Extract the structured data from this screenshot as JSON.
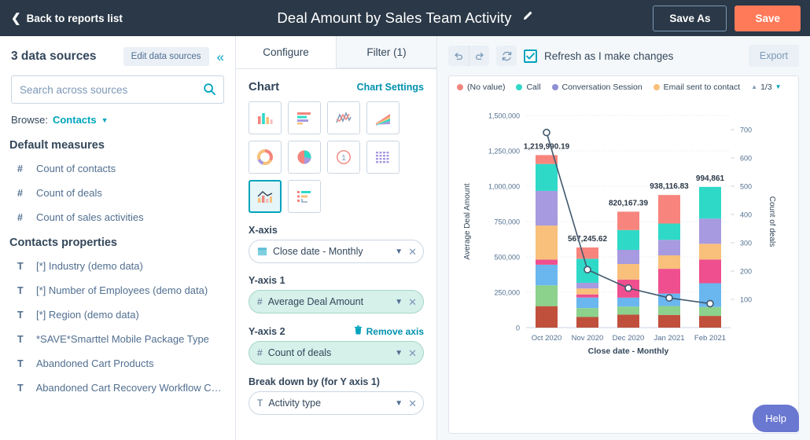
{
  "topbar": {
    "back_label": "Back to reports list",
    "back_icon": "chevron-left-icon",
    "title": "Deal Amount by Sales Team Activity",
    "edit_title_icon": "pencil-icon",
    "save_as_label": "Save As",
    "save_label": "Save",
    "bg_color": "#2a3847",
    "save_color": "#ff7a59"
  },
  "sidebar": {
    "heading": "3 data sources",
    "edit_sources_label": "Edit data sources",
    "collapse_icon": "double-chevron-left-icon",
    "search_placeholder": "Search across sources",
    "search_value": "",
    "search_icon": "search-icon",
    "browse_label": "Browse:",
    "browse_value": "Contacts",
    "sections": [
      {
        "title": "Default measures",
        "items": [
          {
            "icon": "number-icon",
            "glyph": "#",
            "label": "Count of contacts"
          },
          {
            "icon": "number-icon",
            "glyph": "#",
            "label": "Count of deals"
          },
          {
            "icon": "number-icon",
            "glyph": "#",
            "label": "Count of sales activities"
          }
        ]
      },
      {
        "title": "Contacts properties",
        "items": [
          {
            "icon": "text-icon",
            "glyph": "T",
            "label": "[*] Industry (demo data)"
          },
          {
            "icon": "text-icon",
            "glyph": "T",
            "label": "[*] Number of Employees (demo data)"
          },
          {
            "icon": "text-icon",
            "glyph": "T",
            "label": "[*] Region (demo data)"
          },
          {
            "icon": "text-icon",
            "glyph": "T",
            "label": "*SAVE*Smarttel Mobile Package Type"
          },
          {
            "icon": "text-icon",
            "glyph": "T",
            "label": "Abandoned Cart Products"
          },
          {
            "icon": "text-icon",
            "glyph": "T",
            "label": "Abandoned Cart Recovery Workflow Con..."
          }
        ]
      }
    ]
  },
  "configure": {
    "tabs": [
      {
        "label": "Configure",
        "active": true
      },
      {
        "label": "Filter (1)",
        "active": false
      }
    ],
    "chart_heading": "Chart",
    "chart_settings_label": "Chart Settings",
    "chart_types": [
      {
        "name": "vertical-bar-chart-icon",
        "selected": false
      },
      {
        "name": "horizontal-bar-chart-icon",
        "selected": false
      },
      {
        "name": "line-chart-icon",
        "selected": false
      },
      {
        "name": "area-chart-icon",
        "selected": false
      },
      {
        "name": "donut-chart-icon",
        "selected": false
      },
      {
        "name": "pie-chart-icon",
        "selected": false
      },
      {
        "name": "single-value-chart-icon",
        "selected": false
      },
      {
        "name": "table-chart-icon",
        "selected": false
      },
      {
        "name": "combination-chart-icon",
        "selected": true
      },
      {
        "name": "funnel-chart-icon",
        "selected": false
      }
    ],
    "fields": [
      {
        "label": "X-axis",
        "icon": "calendar-icon",
        "value": "Close date - Monthly",
        "green": false
      },
      {
        "label": "Y-axis 1",
        "icon": "number-icon",
        "value": "Average Deal Amount",
        "green": true
      },
      {
        "label": "Y-axis 2",
        "icon": "number-icon",
        "value": "Count of deals",
        "green": true,
        "action": "Remove axis",
        "action_icon": "trash-icon"
      },
      {
        "label": "Break down by (for Y axis 1)",
        "icon": "text-icon",
        "value": "Activity type",
        "green": false
      }
    ]
  },
  "chart_toolbar": {
    "undo_icon": "undo-icon",
    "redo_icon": "redo-icon",
    "refresh_icon": "refresh-icon",
    "refresh_checkbox_label": "Refresh as I make changes",
    "refresh_checkbox_checked": true,
    "export_label": "Export"
  },
  "help": {
    "label": "Help",
    "color": "#6a78d1"
  },
  "chart_data": {
    "type": "bar",
    "subtype": "stacked-bar-with-line",
    "title": "",
    "xlabel": "Close date - Monthly",
    "ylabel": "Average Deal Amount",
    "y2label": "Count of deals",
    "categories": [
      "Oct 2020",
      "Nov 2020",
      "Dec 2020",
      "Jan 2021",
      "Feb 2021"
    ],
    "ylim": [
      0,
      1500000
    ],
    "yticks": [
      0,
      250000,
      500000,
      750000,
      1000000,
      1250000,
      1500000
    ],
    "yticklabels": [
      "0",
      "250,000",
      "500,000",
      "750,000",
      "1,000,000",
      "1,250,000",
      "1,500,000"
    ],
    "y2lim": [
      0,
      750
    ],
    "y2ticks": [
      100,
      200,
      300,
      400,
      500,
      600,
      700
    ],
    "y2ticklabels": [
      "100",
      "200",
      "300",
      "400",
      "500",
      "600",
      "700"
    ],
    "grid": true,
    "legend_position": "top",
    "legend": [
      {
        "label": "(No value)",
        "color": "#f2857d"
      },
      {
        "label": "Call",
        "color": "#2fd9c8"
      },
      {
        "label": "Conversation Session",
        "color": "#8f8fd4"
      },
      {
        "label": "Email sent to contact",
        "color": "#f8c07a"
      }
    ],
    "legend_pager": "1/3",
    "bar_totals": [
      1219990.19,
      567245.62,
      820167.39,
      938116.83,
      994861
    ],
    "bar_total_labels": [
      "1,219,990.19",
      "567,245.62",
      "820,167.39",
      "938,116.83",
      "994,861"
    ],
    "stack_colors": [
      "#c0503c",
      "#8cd18c",
      "#6ab7f0",
      "#ef4f8e",
      "#f8c07a",
      "#a79ae0",
      "#2fd9c8",
      "#f7857d"
    ],
    "stacks": [
      {
        "category": "Oct 2020",
        "segments": [
          152000,
          147000,
          146000,
          36000,
          241000,
          245000,
          190000,
          63000
        ]
      },
      {
        "category": "Nov 2020",
        "segments": [
          75000,
          63000,
          75000,
          22000,
          42000,
          40000,
          170000,
          80000
        ]
      },
      {
        "category": "Dec 2020",
        "segments": [
          92000,
          57000,
          63000,
          128000,
          110000,
          100000,
          140000,
          130000
        ]
      },
      {
        "category": "Jan 2021",
        "segments": [
          90000,
          63000,
          88000,
          175000,
          95000,
          110000,
          115000,
          202000
        ]
      },
      {
        "category": "Feb 2021",
        "segments": [
          83000,
          63000,
          168000,
          168000,
          111000,
          178000,
          224000,
          0
        ]
      }
    ],
    "line_series": {
      "name": "Count of deals",
      "color": "#42586d",
      "values": [
        690,
        205,
        140,
        105,
        85
      ],
      "marker": "circle"
    }
  }
}
